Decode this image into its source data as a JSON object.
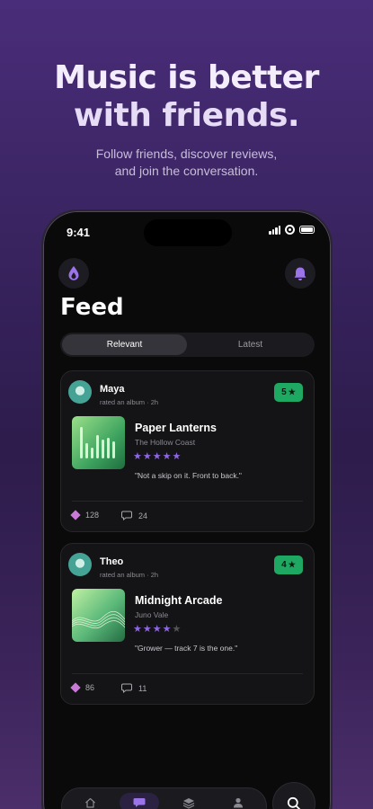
{
  "hero": {
    "title_line1": "Music is better",
    "title_line2": "with friends.",
    "subtitle_line1": "Follow friends, discover reviews,",
    "subtitle_line2": "and join the conversation."
  },
  "status_bar": {
    "time": "9:41"
  },
  "header": {
    "title": "Feed",
    "left_icon": "drop-logo-icon",
    "right_icon": "bell-icon"
  },
  "tabs": [
    {
      "label": "Relevant",
      "active": true
    },
    {
      "label": "Latest",
      "active": false
    }
  ],
  "posts": [
    {
      "user": "Maya",
      "action": "rated an album · 2h",
      "score": "5",
      "album": "Paper Lanterns",
      "artist": "The Hollow Coast",
      "rating_stars": 5,
      "quote": "\"Not a skip on it. Front to back.\"",
      "likes": "128",
      "comments": "24"
    },
    {
      "user": "Theo",
      "action": "rated an album · 2h",
      "score": "4",
      "album": "Midnight Arcade",
      "artist": "Juno Vale",
      "rating_stars": 4,
      "quote": "\"Grower — track 7 is the one.\"",
      "likes": "86",
      "comments": "11"
    }
  ],
  "tab_bar": {
    "items": [
      "home-icon",
      "chat-icon",
      "layers-icon",
      "profile-icon"
    ],
    "active": "chat-icon",
    "fab": "search-icon"
  },
  "colors": {
    "accent": "#8e67e4",
    "score_green": "#1fa862",
    "like_pink": "#c97ad6"
  }
}
